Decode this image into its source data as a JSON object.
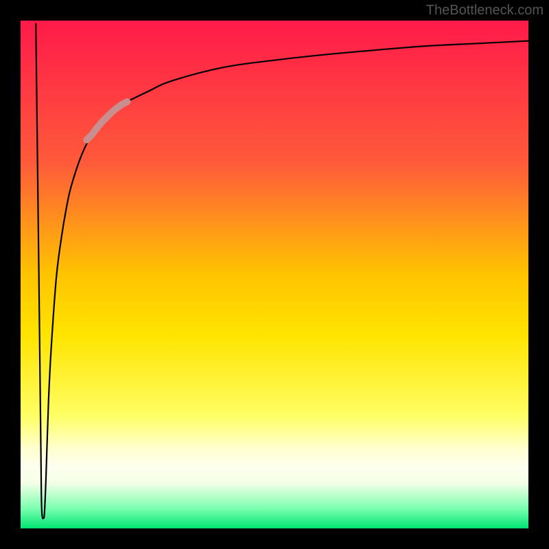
{
  "attribution": "TheBottleneck.com",
  "chart_data": {
    "type": "line",
    "title": "",
    "xlabel": "",
    "ylabel": "",
    "xlim": [
      0,
      100
    ],
    "ylim": [
      0,
      100
    ],
    "gradient_stops": [
      {
        "offset": 0,
        "color": "#ff1a49"
      },
      {
        "offset": 28,
        "color": "#ff5a3a"
      },
      {
        "offset": 50,
        "color": "#ffc400"
      },
      {
        "offset": 62,
        "color": "#ffe400"
      },
      {
        "offset": 78,
        "color": "#ffff66"
      },
      {
        "offset": 84,
        "color": "#ffffcc"
      },
      {
        "offset": 88,
        "color": "#fdfff0"
      },
      {
        "offset": 91,
        "color": "#f4ffe6"
      },
      {
        "offset": 96,
        "color": "#7dffb0"
      },
      {
        "offset": 100,
        "color": "#00e573"
      }
    ],
    "series": [
      {
        "name": "main-curve",
        "x": [
          3.0,
          3.3,
          3.6,
          4.0,
          4.1,
          4.2,
          4.3,
          4.45,
          4.7,
          5.0,
          5.5,
          6.0,
          7.0,
          8.0,
          9.0,
          10.0,
          12.0,
          14.0,
          16.0,
          18.0,
          20.0,
          25.0,
          30.0,
          40.0,
          50.0,
          60.0,
          70.0,
          80.0,
          90.0,
          100.0
        ],
        "y": [
          99.5,
          75.0,
          50.0,
          15.0,
          6.0,
          3.0,
          2.2,
          2.0,
          3.0,
          10.0,
          25.0,
          35.0,
          49.0,
          57.0,
          63.0,
          67.5,
          73.5,
          77.5,
          80.0,
          82.0,
          83.5,
          86.0,
          88.2,
          90.8,
          92.2,
          93.3,
          94.2,
          95.0,
          95.5,
          96.0
        ]
      },
      {
        "name": "highlight-segment",
        "x": [
          13.0,
          14.0,
          15.0,
          16.0,
          17.0,
          18.0,
          19.0,
          20.0,
          21.0
        ],
        "y": [
          76.5,
          77.5,
          78.8,
          80.0,
          81.0,
          82.0,
          82.8,
          83.5,
          84.0
        ]
      }
    ],
    "highlight_color": "#c98e8e",
    "line_color": "#000000"
  }
}
